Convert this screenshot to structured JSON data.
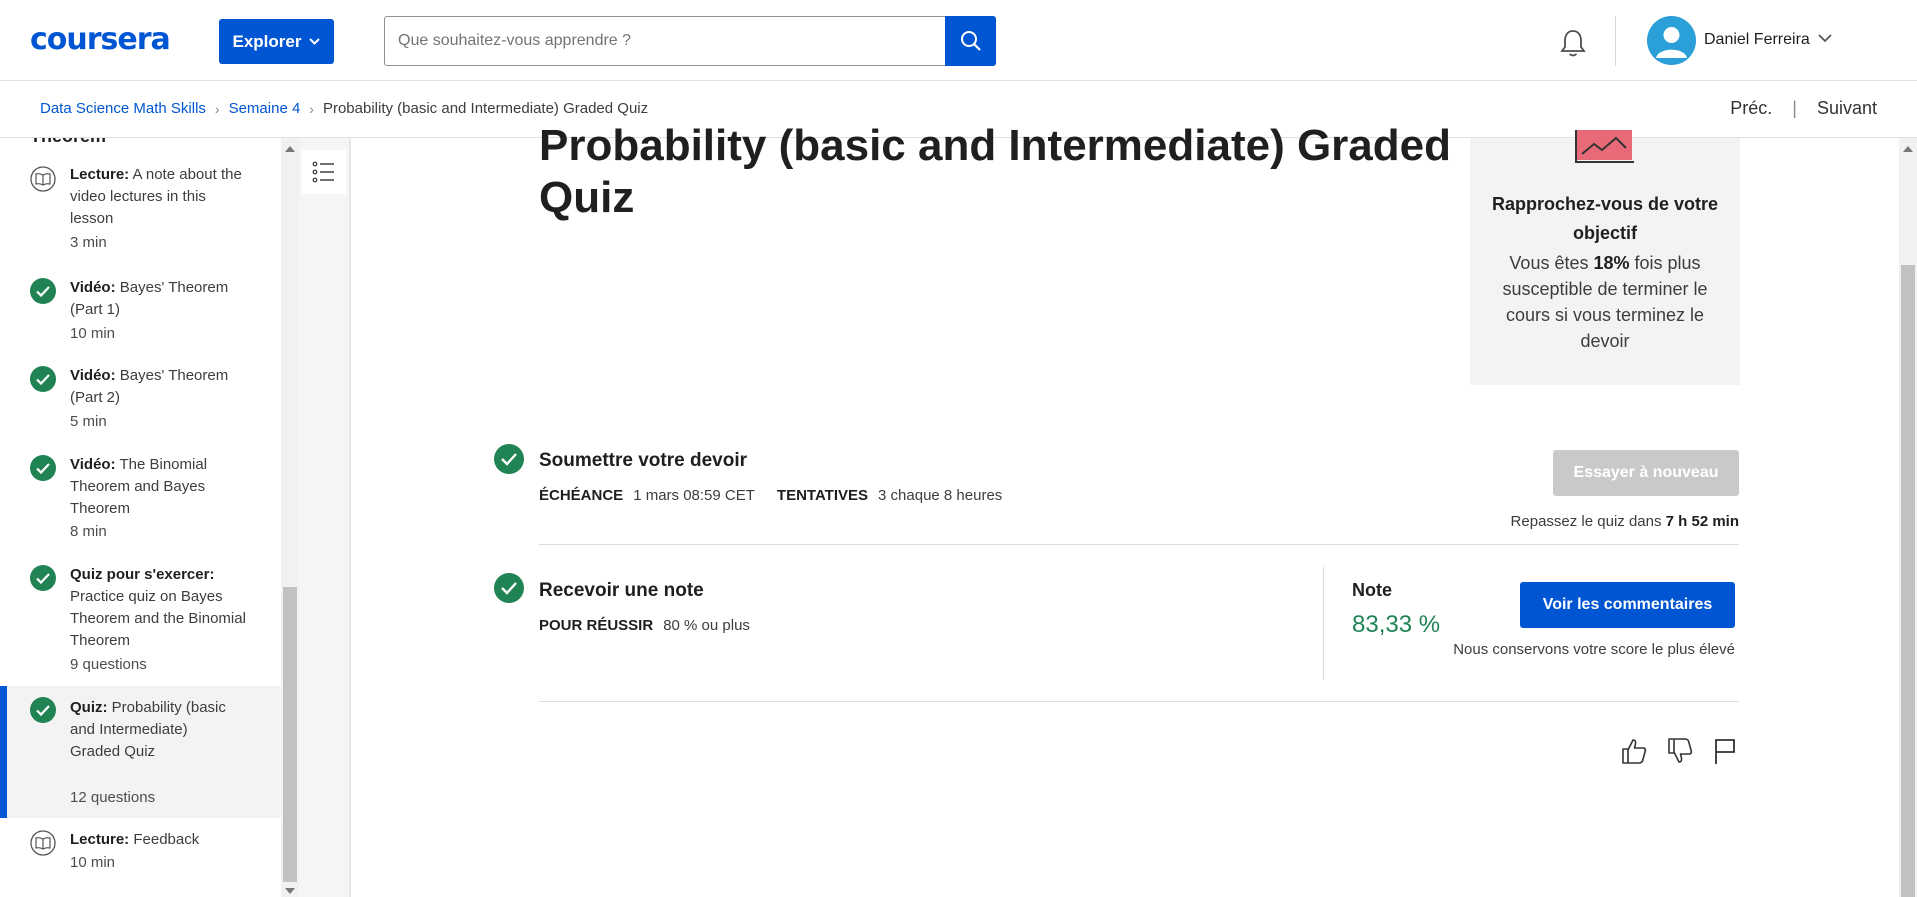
{
  "header": {
    "logo": "coursera",
    "explore_label": "Explorer",
    "search_placeholder": "Que souhaitez-vous apprendre ?",
    "user_name": "Daniel Ferreira"
  },
  "breadcrumb": {
    "items": [
      "Data Science Math Skills",
      "Semaine 4",
      "Probability (basic and Intermediate) Graded Quiz"
    ],
    "prev": "Préc.",
    "next": "Suivant"
  },
  "sidebar": {
    "cut_heading": "Theorem",
    "items": [
      {
        "kind": "Lecture:",
        "title": "A note about the video lectures in this lesson",
        "meta": "3 min",
        "icon": "book-icon",
        "done": false
      },
      {
        "kind": "Vidéo:",
        "title": "Bayes' Theorem (Part 1)",
        "meta": "10 min",
        "icon": "check-icon",
        "done": true
      },
      {
        "kind": "Vidéo:",
        "title": "Bayes' Theorem (Part 2)",
        "meta": "5 min",
        "icon": "check-icon",
        "done": true
      },
      {
        "kind": "Vidéo:",
        "title": "The Binomial Theorem and Bayes Theorem",
        "meta": "8 min",
        "icon": "check-icon",
        "done": true
      },
      {
        "kind": "Quiz pour s'exercer:",
        "title": "Practice quiz on Bayes Theorem and the Binomial Theorem",
        "meta": "9 questions",
        "icon": "check-icon",
        "done": true
      },
      {
        "kind": "Quiz:",
        "title": "Probability (basic and Intermediate) Graded Quiz",
        "meta": "12 questions",
        "icon": "check-icon",
        "done": true,
        "active": true
      },
      {
        "kind": "Lecture:",
        "title": "Feedback",
        "meta": "10 min",
        "icon": "book-icon",
        "done": false
      }
    ]
  },
  "main": {
    "title": "Probability (basic and Intermediate) Graded Quiz",
    "goal": {
      "title": "Rapprochez-vous de votre objectif",
      "body_pre": "Vous êtes ",
      "body_pct": "18%",
      "body_post": " fois plus susceptible de terminer le cours si vous terminez le devoir"
    },
    "submit": {
      "title": "Soumettre votre devoir",
      "due_label": "ÉCHÉANCE",
      "due_value": "1 mars 08:59 CET",
      "attempts_label": "TENTATIVES",
      "attempts_value": "3 chaque 8 heures",
      "retry_button": "Essayer à nouveau",
      "retry_note_pre": "Repassez le quiz dans ",
      "retry_note_time": "7 h 52 min"
    },
    "grade": {
      "title": "Recevoir une note",
      "pass_label": "POUR RÉUSSIR",
      "pass_value": "80 % ou plus",
      "note_label": "Note",
      "note_value": "83,33 %",
      "feedback_button": "Voir les commentaires",
      "score_note": "Nous conservons votre score le plus élevé"
    }
  },
  "colors": {
    "brand": "#0056d2",
    "success": "#1f8354",
    "disabled": "#c9c9c9"
  }
}
